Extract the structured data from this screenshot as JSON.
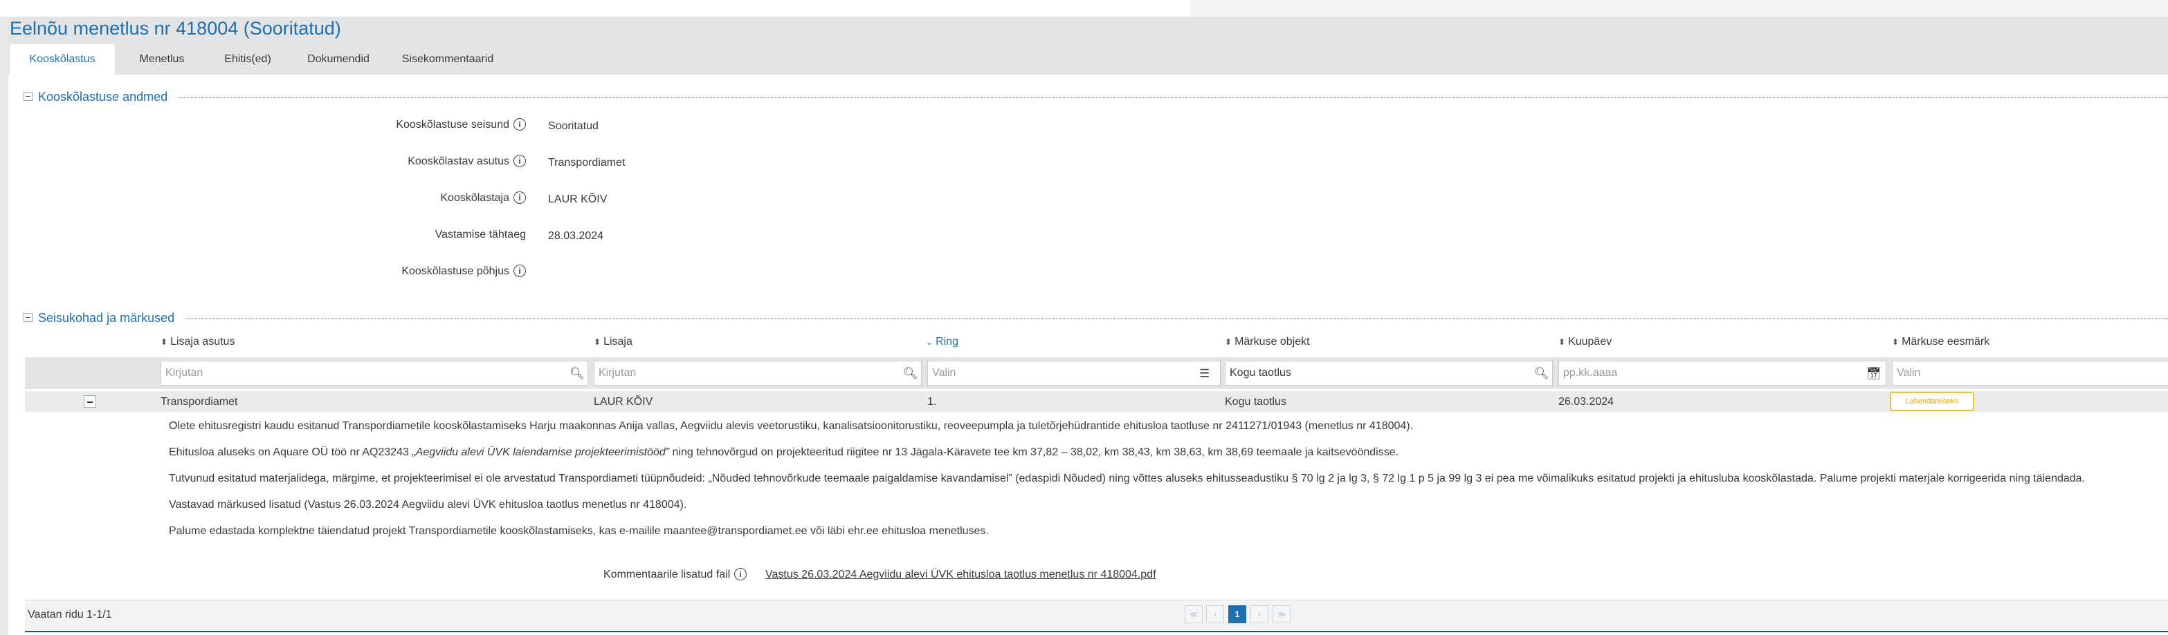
{
  "page": {
    "title": "Eelnõu menetlus nr 418004 (Sooritatud)"
  },
  "tabs": [
    {
      "label": "Kooskõlastus",
      "active": true
    },
    {
      "label": "Menetlus",
      "active": false
    },
    {
      "label": "Ehitis(ed)",
      "active": false
    },
    {
      "label": "Dokumendid",
      "active": false
    },
    {
      "label": "Sisekommentaarid",
      "active": false
    }
  ],
  "section_details": {
    "title": "Kooskõlastuse andmed",
    "fields": [
      {
        "label": "Kooskõlastuse seisund",
        "value": "Sooritatud"
      },
      {
        "label": "Kooskõlastav asutus",
        "value": "Transpordiamet"
      },
      {
        "label": "Kooskõlastaja",
        "value": "LAUR KÕIV"
      },
      {
        "label": "Vastamise tähtaeg",
        "value": "28.03.2024"
      },
      {
        "label": "Kooskõlastuse põhjus",
        "value": ""
      }
    ]
  },
  "section_table": {
    "title": "Seisukohad ja märkused",
    "columns": [
      {
        "label": "Lisaja asutus",
        "sort": "none"
      },
      {
        "label": "Lisaja",
        "sort": "none"
      },
      {
        "label": "Ring",
        "sort": "desc"
      },
      {
        "label": "Märkuse objekt",
        "sort": "none"
      },
      {
        "label": "Kuupäev",
        "sort": "none"
      },
      {
        "label": "Märkuse eesmärk",
        "sort": "none"
      }
    ],
    "filters": [
      {
        "placeholder": "Kirjutan",
        "value": "",
        "icon": "search-icon"
      },
      {
        "placeholder": "Kirjutan",
        "value": "",
        "icon": "search-icon"
      },
      {
        "placeholder": "Valin",
        "value": "",
        "icon": "list-icon"
      },
      {
        "placeholder": "",
        "value": "Kogu taotlus",
        "icon": "search-icon"
      },
      {
        "placeholder": "pp.kk.aaaa",
        "value": "",
        "icon": "calendar-icon"
      },
      {
        "placeholder": "Valin",
        "value": "",
        "icon": ""
      }
    ],
    "row": {
      "asutus": "Transpordiamet",
      "lisaja": "LAUR KÕIV",
      "ring": "1.",
      "objekt": "Kogu taotlus",
      "kuupaev": "26.03.2024",
      "eesmark": "Lahendamiseks"
    },
    "comment": {
      "p1": "Olete ehitusregistri kaudu esitanud Transpordiametile kooskõlastamiseks Harju maakonnas Anija vallas, Aegviidu alevis veetorustiku, kanalisatsioonitorustiku, reoveepumpla ja tuletõrjehüdrantide ehitusloa taotluse nr 2411271/01943 (menetlus nr 418004).",
      "p2_before": "Ehitusloa aluseks on Aquare OÜ töö nr AQ23243 ",
      "p2_italic": "„Aegviidu alevi ÜVK laiendamise projekteerimistööd”",
      "p2_after": " ning tehnovõrgud on projekteeritud riigitee nr 13 Jägala-Käravete tee km 37,82 – 38,02, km 38,43, km 38,63, km 38,69 teemaale ja kaitsevööndisse.",
      "p3": "Tutvunud esitatud materjalidega, märgime, et projekteerimisel ei ole arvestatud Transpordiameti tüüpnõudeid: „Nõuded tehnovõrkude teemaale paigaldamise kavandamisel” (edaspidi Nõuded) ning võttes aluseks ehitusseadustiku § 70 lg 2 ja lg 3, § 72 lg 1 p 5 ja 99 lg 3 ei pea me võimalikuks esitatud projekti ja ehitusluba kooskõlastada. Palume projekti materjale korrigeerida ning täiendada.",
      "p4": "Vastavad märkused lisatud (Vastus 26.03.2024 Aegviidu alevi ÜVK ehitusloa taotlus menetlus nr 418004).",
      "p5": "Palume edastada komplektne täiendatud projekt Transpordiametile kooskõlastamiseks, kas e-mailile maantee@transpordiamet.ee või läbi ehr.ee ehitusloa menetluses."
    },
    "attachment": {
      "label": "Kommentaarile lisatud fail",
      "file": "Vastus 26.03.2024 Aegviidu alevi ÜVK ehitusloa taotlus menetlus nr 418004.pdf"
    },
    "footer": {
      "rows_text": "Vaatan ridu 1-1/1",
      "current_page": "1"
    }
  },
  "colors": {
    "accent": "#1f6fae",
    "header_bg": "#e2e4e6",
    "badge_border": "#f2c230"
  }
}
